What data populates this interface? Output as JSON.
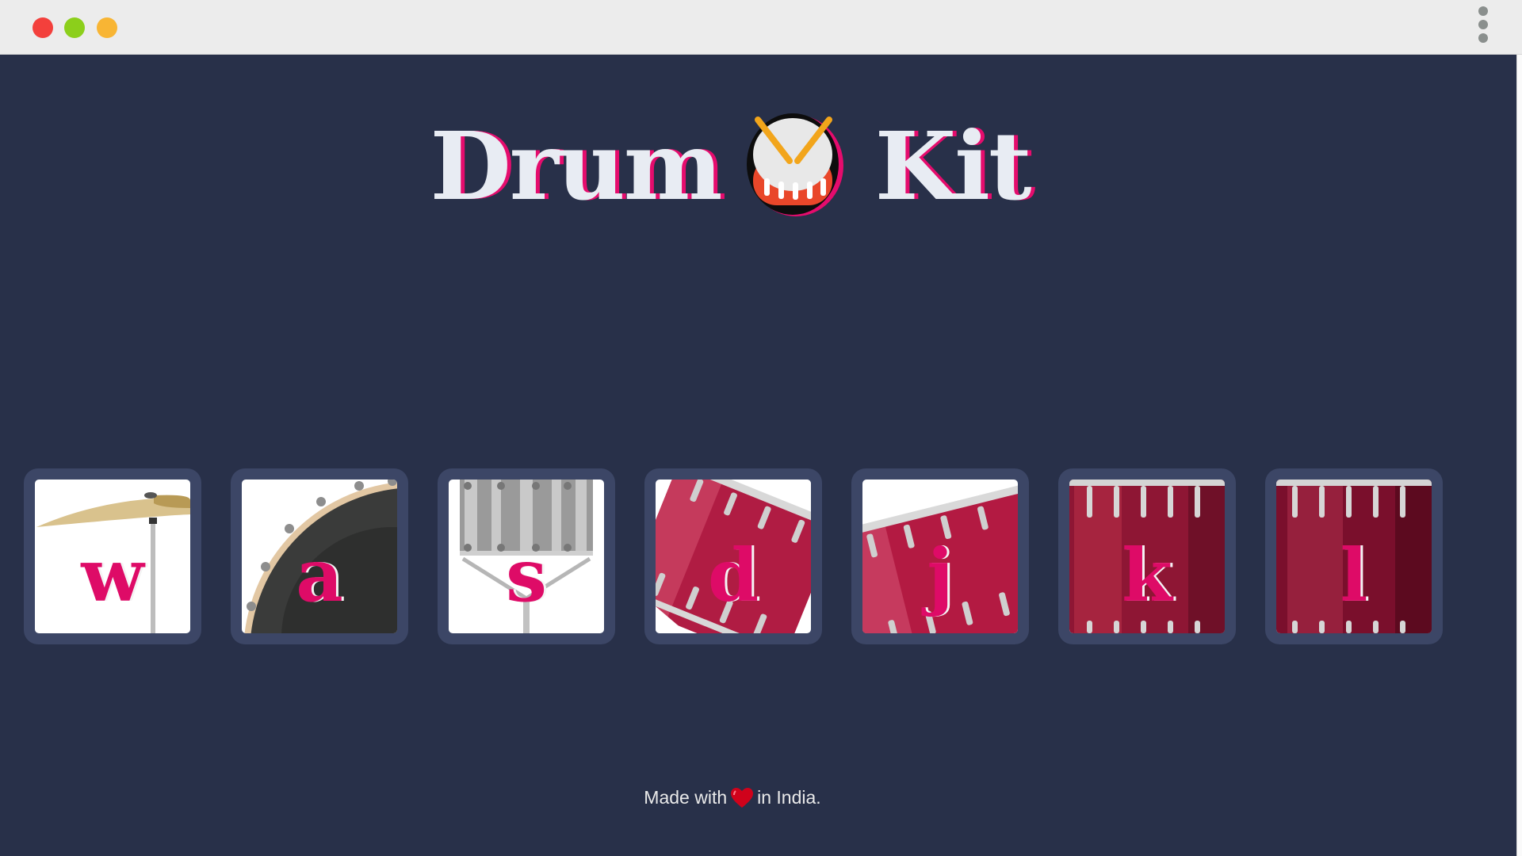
{
  "window": {
    "controls": [
      "close",
      "minimize",
      "maximize"
    ],
    "menu_icon": "kebab-menu-icon"
  },
  "header": {
    "title_left": "Drum",
    "title_right": "Kit",
    "title_icon": "drum-emoji-icon"
  },
  "drums": [
    {
      "key": "w",
      "image": "crash-cymbal"
    },
    {
      "key": "a",
      "image": "kick-bass"
    },
    {
      "key": "s",
      "image": "snare"
    },
    {
      "key": "d",
      "image": "tom-1"
    },
    {
      "key": "j",
      "image": "tom-2"
    },
    {
      "key": "k",
      "image": "tom-3"
    },
    {
      "key": "l",
      "image": "tom-4"
    }
  ],
  "footer": {
    "before": "Made with",
    "icon": "heart-icon",
    "after": "in India."
  },
  "colors": {
    "background": "#283049",
    "pad": "#3c4666",
    "accent": "#de0b67",
    "title": "#e8ecf3"
  }
}
